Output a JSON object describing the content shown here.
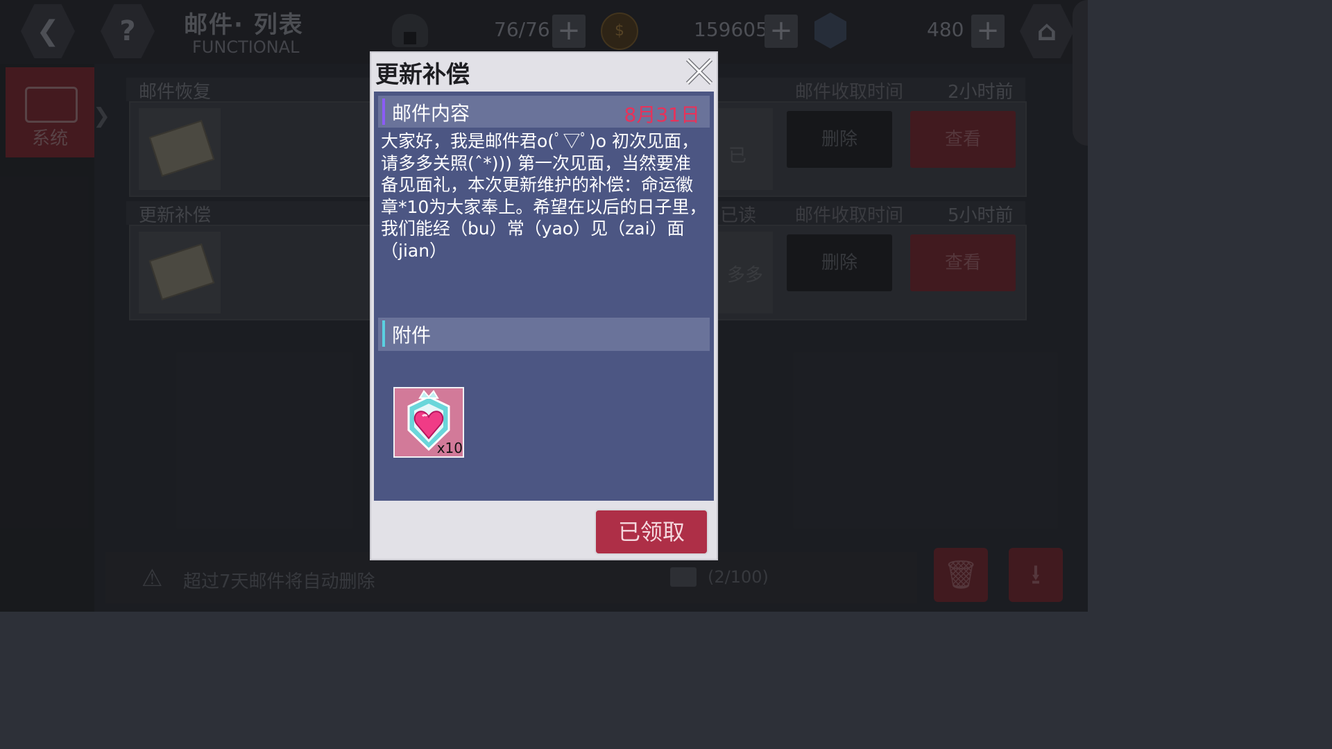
{
  "header": {
    "title_zh": "邮件· 列表",
    "title_en": "FUNCTIONAL",
    "stamina": "76/76",
    "coins": "159605",
    "gems": "480"
  },
  "sidebar": {
    "tabs": [
      {
        "label": "系统"
      }
    ]
  },
  "mail_list": {
    "received_time_label": "邮件收取时间",
    "delete_label": "删除",
    "view_label": "查看",
    "items": [
      {
        "title": "邮件恢复",
        "preview": "已",
        "time": "2小时前"
      },
      {
        "title": "更新补偿",
        "status": "已读",
        "preview": "多多",
        "time": "5小时前"
      }
    ]
  },
  "footer": {
    "warning": "超过7天邮件将自动删除",
    "count": "(2/100)"
  },
  "dialog": {
    "title": "更新补偿",
    "content_header": "邮件内容",
    "date": "8月31日",
    "body": "大家好，我是邮件君o(ﾟ▽ﾟ)o 初次见面，请多多关照(ˆ*))) 第一次见面，当然要准备见面礼，本次更新维护的补偿：命运徽章*10为大家奉上。希望在以后的日子里，我们能经（bu）常（yao）见（zai）面（jian）",
    "attachment_header": "附件",
    "attachment": {
      "icon": "heart-badge-icon",
      "quantity": "x10"
    },
    "claim_button": "已领取"
  },
  "colors": {
    "accent_red": "#ae2f47",
    "date_red": "#e8325a",
    "panel_blue": "#4c5683",
    "section_header": "#6a739a"
  }
}
